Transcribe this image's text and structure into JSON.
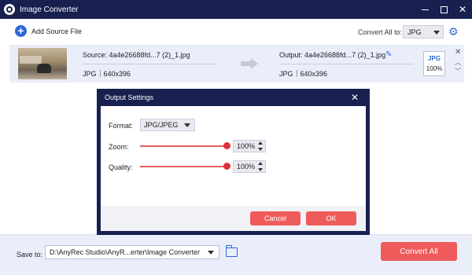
{
  "window": {
    "title": "Image Converter"
  },
  "toolbar": {
    "add_source_label": "Add Source File",
    "convert_all_to_label": "Convert All to:",
    "convert_all_to_value": "JPG"
  },
  "file": {
    "source_label": "Source: 4a4e26688fd...7 (2)_1.jpg",
    "source_format": "JPG",
    "source_dims": "640x396",
    "output_label": "Output: 4a4e26688fd...7 (2)_1.jpg",
    "output_format": "JPG",
    "output_dims": "640x396",
    "badge_format": "JPG",
    "badge_quality": "100%"
  },
  "modal": {
    "title": "Output Settings",
    "format_label": "Format:",
    "format_value": "JPG/JPEG",
    "zoom_label": "Zoom:",
    "zoom_value": "100%",
    "zoom_level": 1.0,
    "quality_label": "Quality:",
    "quality_value": "100%",
    "quality_level": 1.0,
    "cancel_label": "Cancel",
    "ok_label": "OK"
  },
  "bottom": {
    "save_to_label": "Save to:",
    "path_value": "D:\\AnyRec Studio\\AnyR...erter\\Image Converter",
    "convert_all_label": "Convert All"
  },
  "colors": {
    "titlebar": "#17204f",
    "accent": "#2f67d8",
    "action": "#ef5b5b"
  },
  "icons": [
    "app-logo-icon",
    "minimize-icon",
    "maximize-icon",
    "close-icon",
    "plus-icon",
    "gear-icon",
    "arrow-right-icon",
    "edit-icon",
    "chevron-up-icon",
    "chevron-down-icon",
    "folder-icon"
  ]
}
